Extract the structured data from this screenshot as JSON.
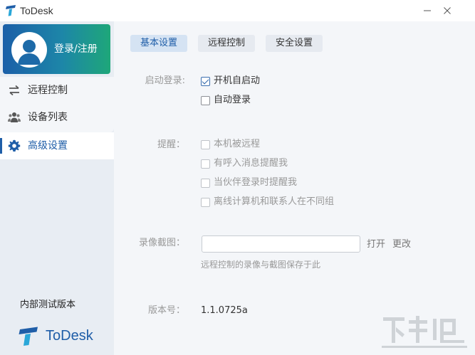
{
  "window": {
    "title": "ToDesk",
    "logo_icon": "todesk-logo-icon",
    "minimize_icon": "minimize-icon",
    "close_icon": "close-icon"
  },
  "sidebar": {
    "login_label": "登录/注册",
    "items": [
      {
        "label": "远程控制",
        "icon": "swap-arrows-icon",
        "active": false
      },
      {
        "label": "设备列表",
        "icon": "users-icon",
        "active": false
      },
      {
        "label": "高级设置",
        "icon": "gear-icon",
        "active": true
      }
    ],
    "version_tag": "内部测试版本",
    "brand_name": "ToDesk"
  },
  "tabs": [
    {
      "label": "基本设置",
      "active": true
    },
    {
      "label": "远程控制",
      "active": false
    },
    {
      "label": "安全设置",
      "active": false
    }
  ],
  "startup": {
    "label": "启动登录:",
    "options": [
      {
        "label": "开机自启动",
        "checked": true,
        "enabled": true
      },
      {
        "label": "自动登录",
        "checked": false,
        "enabled": true
      }
    ]
  },
  "reminder": {
    "label": "提醒：",
    "options": [
      {
        "label": "本机被远程",
        "checked": false,
        "enabled": false
      },
      {
        "label": "有呼入消息提醒我",
        "checked": false,
        "enabled": false
      },
      {
        "label": "当伙伴登录时提醒我",
        "checked": false,
        "enabled": false
      },
      {
        "label": "离线计算机和联系人在不同组",
        "checked": false,
        "enabled": false
      }
    ]
  },
  "recording": {
    "label": "录像截图：",
    "path_value": "",
    "open_label": "打开",
    "change_label": "更改",
    "hint": "远程控制的录像与截图保存于此"
  },
  "version": {
    "label": "版本号：",
    "value": "1.1.0725a"
  },
  "colors": {
    "accent": "#1f5ea8",
    "sidebar_bg": "#e8edf3",
    "main_bg": "#f4f6f9",
    "login_gradient_start": "#1b5fa8",
    "login_gradient_end": "#1ea779"
  }
}
